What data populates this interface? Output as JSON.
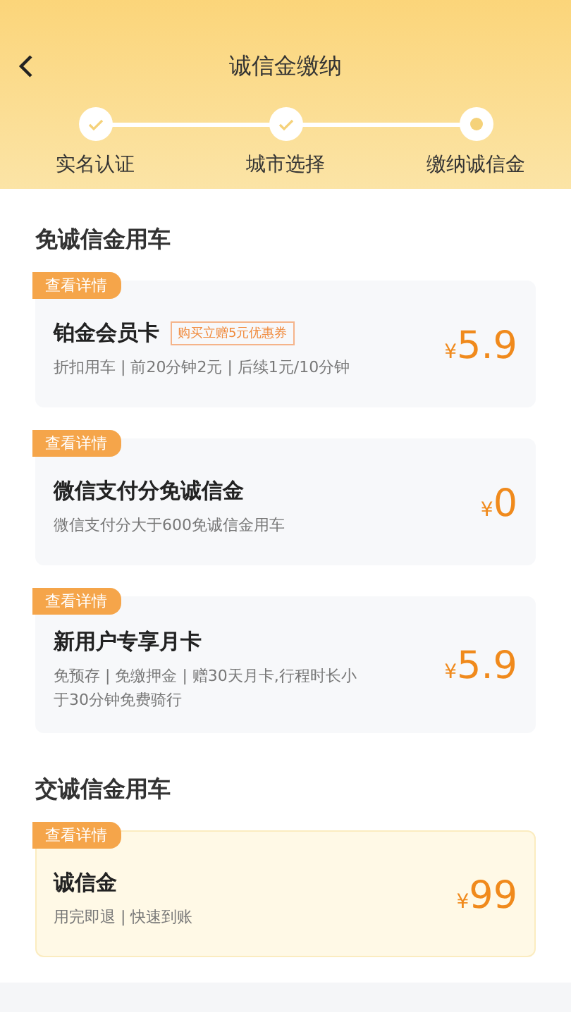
{
  "header": {
    "title": "诚信金缴纳"
  },
  "steps": [
    {
      "label": "实名认证",
      "done": true
    },
    {
      "label": "城市选择",
      "done": true
    },
    {
      "label": "缴纳诚信金",
      "done": false
    }
  ],
  "sections": [
    {
      "title": "免诚信金用车",
      "options": [
        {
          "tag": "查看详情",
          "name": "铂金会员卡",
          "badge": "购买立赠5元优惠券",
          "desc": "折扣用车 | 前20分钟2元 | 后续1元/10分钟",
          "currency": "¥",
          "price": "5.9",
          "selected": false
        },
        {
          "tag": "查看详情",
          "name": "微信支付分免诚信金",
          "desc": "微信支付分大于600免诚信金用车",
          "currency": "¥",
          "price": "0",
          "selected": false
        },
        {
          "tag": "查看详情",
          "name": "新用户专享月卡",
          "desc": "免预存 | 免缴押金 | 赠30天月卡,行程时长小于30分钟免费骑行",
          "currency": "¥",
          "price": "5.9",
          "selected": false
        }
      ]
    },
    {
      "title": "交诚信金用车",
      "options": [
        {
          "tag": "查看详情",
          "name": "诚信金",
          "desc": "用完即退 | 快速到账",
          "currency": "¥",
          "price": "99",
          "selected": true
        }
      ]
    }
  ]
}
